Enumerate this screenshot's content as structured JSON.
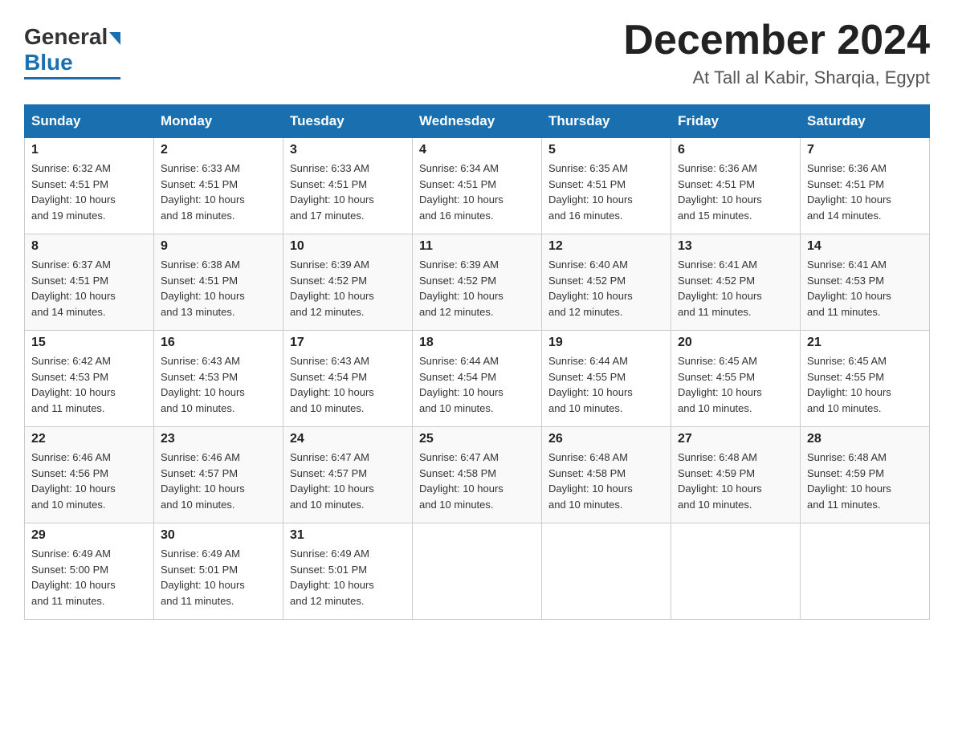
{
  "logo": {
    "general": "General",
    "blue": "Blue"
  },
  "title": "December 2024",
  "subtitle": "At Tall al Kabir, Sharqia, Egypt",
  "days_of_week": [
    "Sunday",
    "Monday",
    "Tuesday",
    "Wednesday",
    "Thursday",
    "Friday",
    "Saturday"
  ],
  "weeks": [
    [
      {
        "num": "1",
        "sunrise": "6:32 AM",
        "sunset": "4:51 PM",
        "daylight": "10 hours and 19 minutes."
      },
      {
        "num": "2",
        "sunrise": "6:33 AM",
        "sunset": "4:51 PM",
        "daylight": "10 hours and 18 minutes."
      },
      {
        "num": "3",
        "sunrise": "6:33 AM",
        "sunset": "4:51 PM",
        "daylight": "10 hours and 17 minutes."
      },
      {
        "num": "4",
        "sunrise": "6:34 AM",
        "sunset": "4:51 PM",
        "daylight": "10 hours and 16 minutes."
      },
      {
        "num": "5",
        "sunrise": "6:35 AM",
        "sunset": "4:51 PM",
        "daylight": "10 hours and 16 minutes."
      },
      {
        "num": "6",
        "sunrise": "6:36 AM",
        "sunset": "4:51 PM",
        "daylight": "10 hours and 15 minutes."
      },
      {
        "num": "7",
        "sunrise": "6:36 AM",
        "sunset": "4:51 PM",
        "daylight": "10 hours and 14 minutes."
      }
    ],
    [
      {
        "num": "8",
        "sunrise": "6:37 AM",
        "sunset": "4:51 PM",
        "daylight": "10 hours and 14 minutes."
      },
      {
        "num": "9",
        "sunrise": "6:38 AM",
        "sunset": "4:51 PM",
        "daylight": "10 hours and 13 minutes."
      },
      {
        "num": "10",
        "sunrise": "6:39 AM",
        "sunset": "4:52 PM",
        "daylight": "10 hours and 12 minutes."
      },
      {
        "num": "11",
        "sunrise": "6:39 AM",
        "sunset": "4:52 PM",
        "daylight": "10 hours and 12 minutes."
      },
      {
        "num": "12",
        "sunrise": "6:40 AM",
        "sunset": "4:52 PM",
        "daylight": "10 hours and 12 minutes."
      },
      {
        "num": "13",
        "sunrise": "6:41 AM",
        "sunset": "4:52 PM",
        "daylight": "10 hours and 11 minutes."
      },
      {
        "num": "14",
        "sunrise": "6:41 AM",
        "sunset": "4:53 PM",
        "daylight": "10 hours and 11 minutes."
      }
    ],
    [
      {
        "num": "15",
        "sunrise": "6:42 AM",
        "sunset": "4:53 PM",
        "daylight": "10 hours and 11 minutes."
      },
      {
        "num": "16",
        "sunrise": "6:43 AM",
        "sunset": "4:53 PM",
        "daylight": "10 hours and 10 minutes."
      },
      {
        "num": "17",
        "sunrise": "6:43 AM",
        "sunset": "4:54 PM",
        "daylight": "10 hours and 10 minutes."
      },
      {
        "num": "18",
        "sunrise": "6:44 AM",
        "sunset": "4:54 PM",
        "daylight": "10 hours and 10 minutes."
      },
      {
        "num": "19",
        "sunrise": "6:44 AM",
        "sunset": "4:55 PM",
        "daylight": "10 hours and 10 minutes."
      },
      {
        "num": "20",
        "sunrise": "6:45 AM",
        "sunset": "4:55 PM",
        "daylight": "10 hours and 10 minutes."
      },
      {
        "num": "21",
        "sunrise": "6:45 AM",
        "sunset": "4:55 PM",
        "daylight": "10 hours and 10 minutes."
      }
    ],
    [
      {
        "num": "22",
        "sunrise": "6:46 AM",
        "sunset": "4:56 PM",
        "daylight": "10 hours and 10 minutes."
      },
      {
        "num": "23",
        "sunrise": "6:46 AM",
        "sunset": "4:57 PM",
        "daylight": "10 hours and 10 minutes."
      },
      {
        "num": "24",
        "sunrise": "6:47 AM",
        "sunset": "4:57 PM",
        "daylight": "10 hours and 10 minutes."
      },
      {
        "num": "25",
        "sunrise": "6:47 AM",
        "sunset": "4:58 PM",
        "daylight": "10 hours and 10 minutes."
      },
      {
        "num": "26",
        "sunrise": "6:48 AM",
        "sunset": "4:58 PM",
        "daylight": "10 hours and 10 minutes."
      },
      {
        "num": "27",
        "sunrise": "6:48 AM",
        "sunset": "4:59 PM",
        "daylight": "10 hours and 10 minutes."
      },
      {
        "num": "28",
        "sunrise": "6:48 AM",
        "sunset": "4:59 PM",
        "daylight": "10 hours and 11 minutes."
      }
    ],
    [
      {
        "num": "29",
        "sunrise": "6:49 AM",
        "sunset": "5:00 PM",
        "daylight": "10 hours and 11 minutes."
      },
      {
        "num": "30",
        "sunrise": "6:49 AM",
        "sunset": "5:01 PM",
        "daylight": "10 hours and 11 minutes."
      },
      {
        "num": "31",
        "sunrise": "6:49 AM",
        "sunset": "5:01 PM",
        "daylight": "10 hours and 12 minutes."
      },
      null,
      null,
      null,
      null
    ]
  ],
  "labels": {
    "sunrise": "Sunrise:",
    "sunset": "Sunset:",
    "daylight": "Daylight:"
  }
}
